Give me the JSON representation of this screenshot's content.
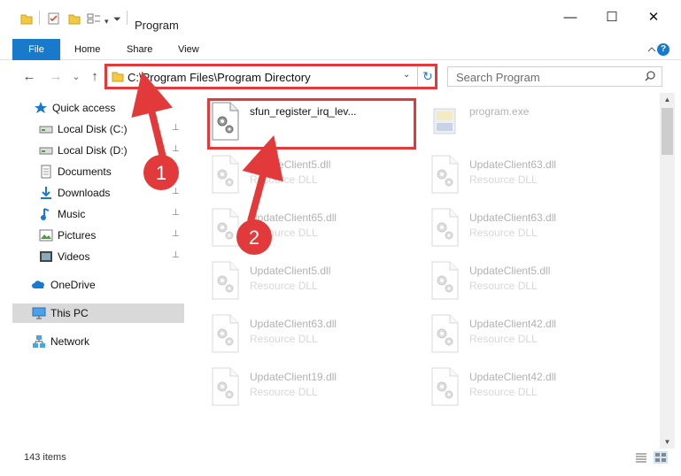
{
  "window": {
    "title": "Program",
    "minimize_glyph": "—",
    "maximize_glyph": "☐",
    "close_glyph": "✕"
  },
  "ribbon": {
    "tabs": [
      "File",
      "Home",
      "Share",
      "View"
    ],
    "help_glyph": "?"
  },
  "address_bar": {
    "path": "C:\\Program Files\\Program Directory",
    "dropdown_glyph": "⌄",
    "refresh_glyph": "↻"
  },
  "nav_buttons": {
    "back_glyph": "←",
    "forward_glyph": "→",
    "recent_glyph": "⌄",
    "up_glyph": "↑"
  },
  "search": {
    "placeholder": "Search Program"
  },
  "sidebar": {
    "items": [
      {
        "label": "Quick access",
        "icon": "star-icon",
        "pinned": false
      },
      {
        "label": "Local Disk (C:)",
        "icon": "drive-icon",
        "pinned": true
      },
      {
        "label": "Local Disk (D:)",
        "icon": "drive-icon",
        "pinned": true
      },
      {
        "label": "Documents",
        "icon": "documents-icon",
        "pinned": true
      },
      {
        "label": "Downloads",
        "icon": "download-icon",
        "pinned": true
      },
      {
        "label": "Music",
        "icon": "music-icon",
        "pinned": true
      },
      {
        "label": "Pictures",
        "icon": "pictures-icon",
        "pinned": true
      },
      {
        "label": "Videos",
        "icon": "videos-icon",
        "pinned": true
      },
      {
        "label": "OneDrive",
        "icon": "cloud-icon",
        "pinned": false
      },
      {
        "label": "This PC",
        "icon": "computer-icon",
        "pinned": false,
        "selected": true
      },
      {
        "label": "Network",
        "icon": "network-icon",
        "pinned": false
      }
    ],
    "pin_glyph": "📌"
  },
  "files": [
    {
      "name": "sfun_register_irq_lev...",
      "type": "",
      "highlighted": true
    },
    {
      "name": "program.exe",
      "type": "",
      "faded": true,
      "exe": true
    },
    {
      "name": "UpdateClient5.dll",
      "type": "Resource DLL",
      "faded": true
    },
    {
      "name": "UpdateClient63.dll",
      "type": "Resource DLL",
      "faded": true
    },
    {
      "name": "UpdateClient65.dll",
      "type": "Resource DLL",
      "faded": true
    },
    {
      "name": "UpdateClient63.dll",
      "type": "Resource DLL",
      "faded": true
    },
    {
      "name": "UpdateClient5.dll",
      "type": "Resource DLL",
      "faded": true
    },
    {
      "name": "UpdateClient5.dll",
      "type": "Resource DLL",
      "faded": true
    },
    {
      "name": "UpdateClient63.dll",
      "type": "Resource DLL",
      "faded": true
    },
    {
      "name": "UpdateClient42.dll",
      "type": "Resource DLL",
      "faded": true
    },
    {
      "name": "UpdateClient19.dll",
      "type": "Resource DLL",
      "faded": true
    },
    {
      "name": "UpdateClient42.dll",
      "type": "Resource DLL",
      "faded": true
    }
  ],
  "status": {
    "item_count": "143 items"
  },
  "annotations": {
    "step1": "1",
    "step2": "2"
  },
  "colors": {
    "accent": "#1979ca",
    "annotation_red": "#e23a3a",
    "selected_bg": "#d9d9d9"
  }
}
